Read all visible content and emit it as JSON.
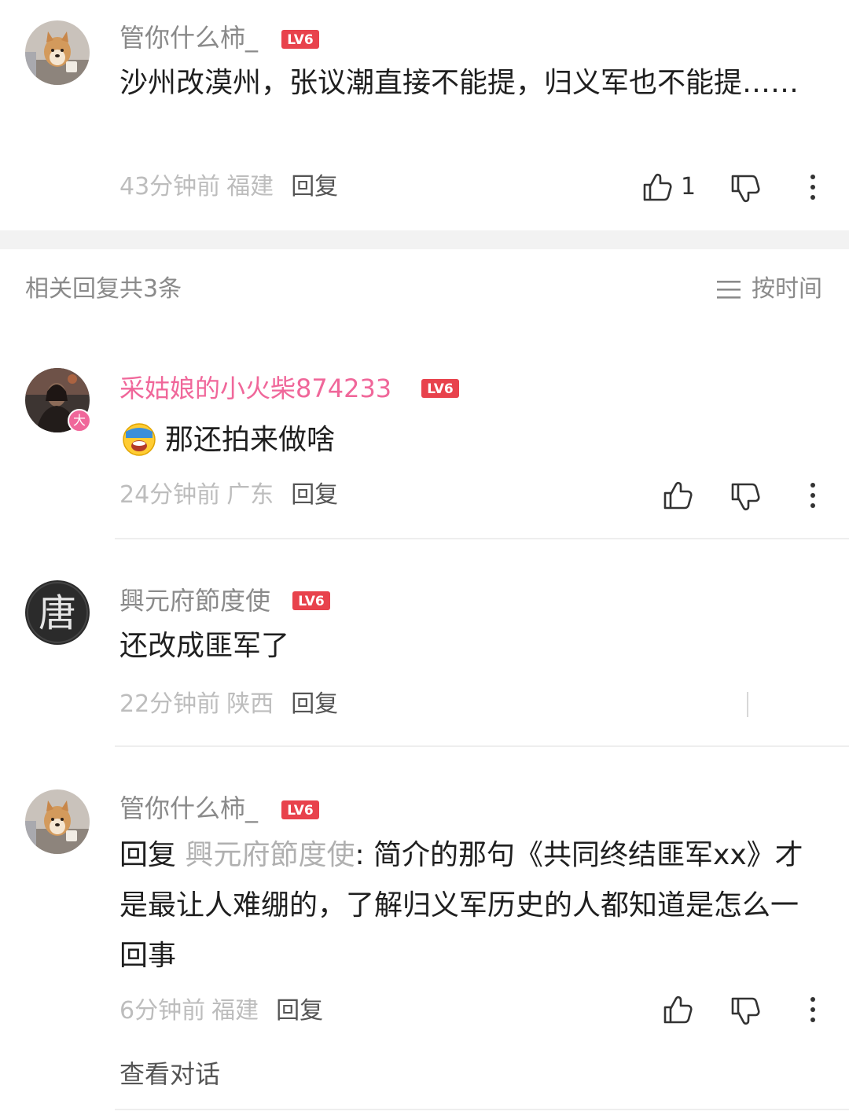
{
  "main_comment": {
    "username": "管你什么柿_",
    "level": "LV6",
    "text": "沙州改漠州，张议潮直接不能提，归义军也不能提……",
    "time": "43分钟前",
    "location": "福建",
    "reply_label": "回复",
    "like_count": "1"
  },
  "replies_header": {
    "title": "相关回复共3条",
    "sort_label": "按时间"
  },
  "replies": [
    {
      "username": "采姑娘的小火柴874233",
      "level": "LV6",
      "badge": "大",
      "text": "那还拍来做啥",
      "time": "24分钟前",
      "location": "广东",
      "reply_label": "回复"
    },
    {
      "username": "興元府節度使",
      "level": "LV6",
      "avatar_char": "唐",
      "text": "还改成匪军了",
      "time": "22分钟前",
      "location": "陕西",
      "reply_label": "回复"
    },
    {
      "username": "管你什么柿_",
      "level": "LV6",
      "reply_prefix": "回复",
      "mention": "興元府節度使",
      "text_after": ": 简介的那句《共同终结匪军xx》才是最让人难绷的，了解归义军历史的人都知道是怎么一回事",
      "time": "6分钟前",
      "location": "福建",
      "reply_label": "回复"
    }
  ],
  "view_thread_label": "查看对话",
  "colors": {
    "pink_username": "#f0679a",
    "level_badge": "#e8424c",
    "secondary_text": "#8a8a8a",
    "meta_text": "#bdbdbd"
  }
}
